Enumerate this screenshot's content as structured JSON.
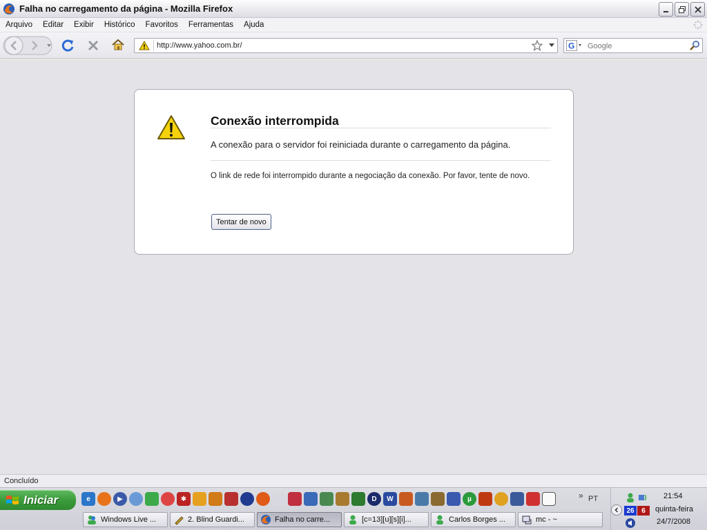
{
  "window": {
    "title": "Falha no carregamento da página - Mozilla Firefox"
  },
  "menu": [
    "Arquivo",
    "Editar",
    "Exibir",
    "Histórico",
    "Favoritos",
    "Ferramentas",
    "Ajuda"
  ],
  "navbar": {
    "url": "http://www.yahoo.com.br/",
    "search_placeholder": "Google",
    "search_engine_icon": "google-icon"
  },
  "error": {
    "title": "Conexão interrompida",
    "short_desc": "A conexão para o servidor foi reiniciada durante o carregamento da página.",
    "long_desc": "O link de rede foi interrompido durante a negociação da conexão. Por favor, tente de novo.",
    "retry_label": "Tentar de novo"
  },
  "status": {
    "text": "Concluído"
  },
  "taskbar": {
    "start_label": "Iniciar",
    "quick_launch_more": "»",
    "language": "PT",
    "tasks": [
      {
        "label": "Windows Live ...",
        "icon": "messenger-icon",
        "active": false
      },
      {
        "label": "2. Blind Guardi...",
        "icon": "music-icon",
        "active": false
      },
      {
        "label": "Falha no carre...",
        "icon": "firefox-icon",
        "active": true
      },
      {
        "label": "[c=13][u][s][i]...",
        "icon": "chat-icon",
        "active": false
      },
      {
        "label": "Carlos Borges ...",
        "icon": "chat-icon",
        "active": false
      },
      {
        "label": "mc - ~",
        "icon": "terminal-icon",
        "active": false
      }
    ]
  },
  "tray": {
    "badge_blue": "26",
    "badge_red": "6",
    "time": "21:54",
    "day": "quinta-feira",
    "date": "24/7/2008"
  },
  "colors": {
    "start_green": "#3a9a3a",
    "content_bg": "#e4e4e8",
    "warning_yellow": "#f5d20a"
  }
}
